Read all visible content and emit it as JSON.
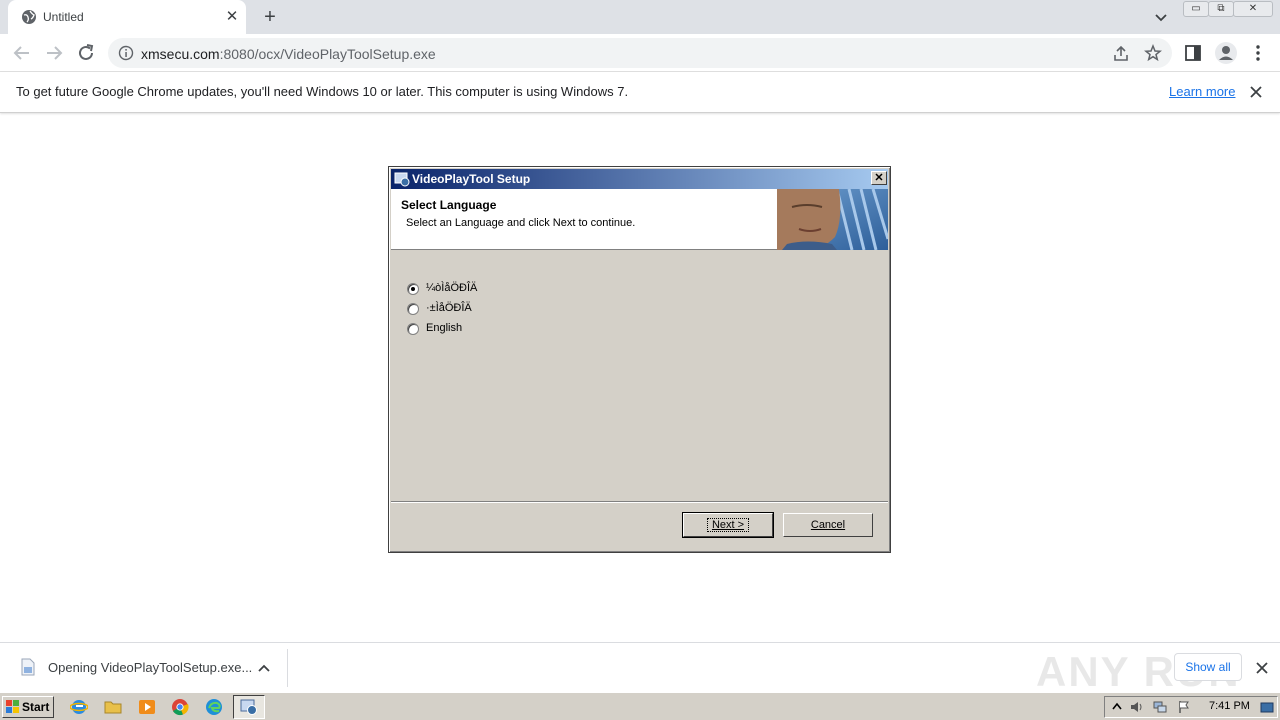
{
  "browser": {
    "tab_title": "Untitled",
    "url_host": "xmsecu.com",
    "url_rest": ":8080/ocx/VideoPlayToolSetup.exe"
  },
  "infobar": {
    "message": "To get future Google Chrome updates, you'll need Windows 10 or later. This computer is using Windows 7.",
    "learn_more": "Learn more"
  },
  "dialog": {
    "title": "VideoPlayTool Setup",
    "header_title": "Select Language",
    "header_subtitle": "Select an Language and click Next to continue.",
    "options": [
      {
        "label": "¼òÌåÖÐÎÄ",
        "checked": true
      },
      {
        "label": "·±ÌåÖÐÎÄ",
        "checked": false
      },
      {
        "label": "English",
        "checked": false
      }
    ],
    "next_label": "Next >",
    "cancel_label": "Cancel"
  },
  "downloads": {
    "item_text": "Opening VideoPlayToolSetup.exe...",
    "show_all": "Show all",
    "watermark": "ANY RUN"
  },
  "taskbar": {
    "start_label": "Start",
    "clock": "7:41 PM"
  },
  "colors": {
    "titlebar_start": "#0a246a",
    "titlebar_end": "#a6caf0",
    "link_blue": "#1a73e8",
    "dialog_face": "#d4d0c8"
  }
}
